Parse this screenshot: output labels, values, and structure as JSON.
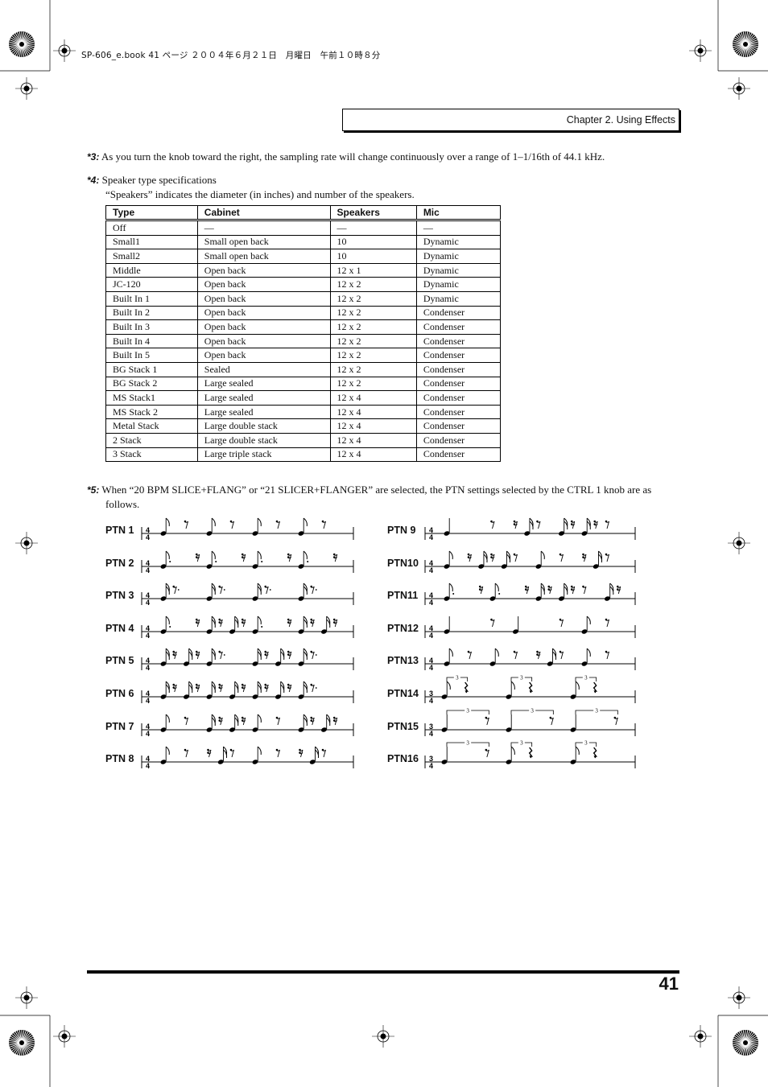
{
  "slug": "SP-606_e.book  41 ページ  ２００４年６月２１日　月曜日　午前１０時８分",
  "header": {
    "chapter": "Chapter 2. Using Effects"
  },
  "note3": {
    "marker": "*3:",
    "text": "As you turn the knob toward the right, the sampling rate will change continuously over a range of 1–1/16th of 44.1 kHz."
  },
  "note4": {
    "marker": "*4:",
    "text": "Speaker type specifications",
    "subtext": "“Speakers” indicates the diameter (in inches) and number of the speakers."
  },
  "speaker_table": {
    "columns": [
      "Type",
      "Cabinet",
      "Speakers",
      "Mic"
    ],
    "rows": [
      [
        "Off",
        "—",
        "—",
        "—"
      ],
      [
        "Small1",
        "Small open back",
        "10",
        "Dynamic"
      ],
      [
        "Small2",
        "Small open back",
        "10",
        "Dynamic"
      ],
      [
        "Middle",
        "Open back",
        "12 x 1",
        "Dynamic"
      ],
      [
        "JC-120",
        "Open back",
        "12 x 2",
        "Dynamic"
      ],
      [
        "Built In 1",
        "Open back",
        "12 x 2",
        "Dynamic"
      ],
      [
        "Built In 2",
        "Open back",
        "12 x 2",
        "Condenser"
      ],
      [
        "Built In 3",
        "Open back",
        "12 x 2",
        "Condenser"
      ],
      [
        "Built In 4",
        "Open back",
        "12 x 2",
        "Condenser"
      ],
      [
        "Built In 5",
        "Open back",
        "12 x 2",
        "Condenser"
      ],
      [
        "BG Stack 1",
        "Sealed",
        "12 x 2",
        "Condenser"
      ],
      [
        "BG Stack 2",
        "Large sealed",
        "12 x 2",
        "Condenser"
      ],
      [
        "MS Stack1",
        "Large sealed",
        "12 x 4",
        "Condenser"
      ],
      [
        "MS Stack 2",
        "Large sealed",
        "12 x 4",
        "Condenser"
      ],
      [
        "Metal Stack",
        "Large double stack",
        "12 x 4",
        "Condenser"
      ],
      [
        "2 Stack",
        "Large double stack",
        "12 x 4",
        "Condenser"
      ],
      [
        "3 Stack",
        "Large triple stack",
        "12 x 4",
        "Condenser"
      ]
    ]
  },
  "note5": {
    "marker": "*5:",
    "text": "When “20 BPM SLICE+FLANG” or “21 SLICER+FLANGER” are selected, the PTN settings selected by the CTRL 1 knob are as",
    "text2": "follows."
  },
  "patterns": [
    {
      "label": "PTN 1",
      "time": [
        "4",
        "4"
      ],
      "tokens": [
        "n8",
        "r8",
        "n8",
        "r8",
        "n8",
        "r8",
        "n8",
        "r8"
      ]
    },
    {
      "label": "PTN 2",
      "time": [
        "4",
        "4"
      ],
      "tokens": [
        "n8d",
        "r16",
        "n8d",
        "r16",
        "n8d",
        "r16",
        "n8d",
        "r16"
      ]
    },
    {
      "label": "PTN 3",
      "time": [
        "4",
        "4"
      ],
      "tokens": [
        "n16",
        "r8d",
        "n16",
        "r8d",
        "n16",
        "r8d",
        "n16",
        "r8d"
      ]
    },
    {
      "label": "PTN 4",
      "time": [
        "4",
        "4"
      ],
      "tokens": [
        "n8d",
        "r16",
        "n16",
        "r16",
        "n16",
        "r16",
        "n8d",
        "r16",
        "n16",
        "r16",
        "n16",
        "r16"
      ]
    },
    {
      "label": "PTN 5",
      "time": [
        "4",
        "4"
      ],
      "tokens": [
        "n16",
        "r16",
        "n16",
        "r16",
        "n16",
        "r8d",
        "n16",
        "r16",
        "n16",
        "r16",
        "n16",
        "r8d"
      ]
    },
    {
      "label": "PTN 6",
      "time": [
        "4",
        "4"
      ],
      "tokens": [
        "n16",
        "r16",
        "n16",
        "r16",
        "n16",
        "r16",
        "n16",
        "r16",
        "n16",
        "r16",
        "n16",
        "r16",
        "n16",
        "r8d"
      ]
    },
    {
      "label": "PTN 7",
      "time": [
        "4",
        "4"
      ],
      "tokens": [
        "n8",
        "r8",
        "n16",
        "r16",
        "n16",
        "r16",
        "n8",
        "r8",
        "n16",
        "r16",
        "n16",
        "r16"
      ]
    },
    {
      "label": "PTN 8",
      "time": [
        "4",
        "4"
      ],
      "tokens": [
        "n8",
        "r8",
        "r16",
        "n16",
        "r8",
        "n8",
        "r8",
        "r16",
        "n16",
        "r8"
      ]
    },
    {
      "label": "PTN 9",
      "time": [
        "4",
        "4"
      ],
      "tokens": [
        "n4",
        "r8",
        "r16",
        "n16",
        "r8",
        "n16",
        "r16",
        "n16",
        "r16",
        "r8"
      ]
    },
    {
      "label": "PTN10",
      "time": [
        "4",
        "4"
      ],
      "tokens": [
        "n8",
        "r16",
        "n16",
        "r16",
        "n16",
        "r8",
        "n8",
        "r8",
        "r16",
        "n16",
        "r8"
      ]
    },
    {
      "label": "PTN11",
      "time": [
        "4",
        "4"
      ],
      "tokens": [
        "n8d",
        "r16",
        "n8d",
        "r16",
        "n16",
        "r16",
        "n16",
        "r16",
        "r8",
        "n16",
        "r16"
      ]
    },
    {
      "label": "PTN12",
      "time": [
        "4",
        "4"
      ],
      "tokens": [
        "n4",
        "r8",
        "n4",
        "r8",
        "n8",
        "r8"
      ]
    },
    {
      "label": "PTN13",
      "time": [
        "4",
        "4"
      ],
      "tokens": [
        "n8",
        "r8",
        "n8",
        "r8",
        "r16",
        "n16",
        "r8",
        "n8",
        "r8"
      ]
    },
    {
      "label": "PTN14",
      "time": [
        "3",
        "4"
      ],
      "triplet": "3",
      "tokens": [
        "n8",
        "r4",
        "n8",
        "r4",
        "n8",
        "r4"
      ]
    },
    {
      "label": "PTN15",
      "time": [
        "3",
        "4"
      ],
      "triplet": "3",
      "tokens": [
        "n4",
        "r8",
        "n4",
        "r8",
        "n4",
        "r8"
      ]
    },
    {
      "label": "PTN16",
      "time": [
        "3",
        "4"
      ],
      "triplet": "3",
      "tokens": [
        "n4",
        "r8",
        "n8",
        "r4",
        "n8",
        "r4"
      ]
    }
  ],
  "footer": {
    "page_number": "41"
  },
  "icons": {
    "registration": "registration-mark-icon",
    "color_bar": "sunburst-target-icon"
  }
}
